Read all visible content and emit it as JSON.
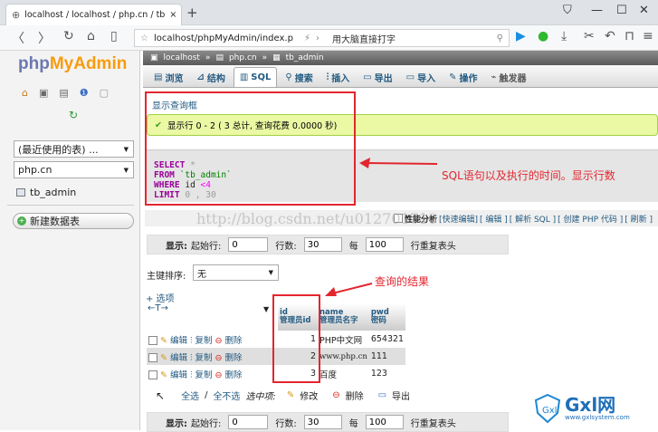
{
  "browser": {
    "tab_title": "localhost / localhost / php.cn / tb",
    "url": "localhost/phpMyAdmin/index.p",
    "url_extra": "用大脑直接打字"
  },
  "sidebar": {
    "logo_php": "php",
    "logo_myadmin": "MyAdmin",
    "recent_select": "(最近使用的表) ...",
    "db_select": "php.cn",
    "table_item": "tb_admin",
    "new_table": "新建数据表"
  },
  "breadcrumb": {
    "server": "localhost",
    "database": "php.cn",
    "table": "tb_admin"
  },
  "menu": {
    "items": [
      "浏览",
      "结构",
      "SQL",
      "搜索",
      "插入",
      "导出",
      "导入",
      "操作",
      "触发器"
    ]
  },
  "query": {
    "show_box_link": "显示查询框",
    "success_msg": "显示行 0 - 2 ( 3 总计, 查询花费 0.0000 秒)",
    "sql_select": "SELECT",
    "sql_star": "*",
    "sql_from": "FROM",
    "sql_table": "`tb_admin`",
    "sql_where": "WHERE",
    "sql_col": "id",
    "sql_op": "<",
    "sql_val": "4",
    "sql_limit": "LIMIT",
    "sql_limit_vals": "0 , 30"
  },
  "toolbar": {
    "profiling": "性能分析",
    "inline_edit": "[快速编辑]",
    "edit": "[ 编辑 ]",
    "explain": "[ 解析 SQL ]",
    "create_php": "[ 创建 PHP 代码 ]",
    "refresh": "[ 刷新 ]"
  },
  "watermark": "http://blog.csdn.net/u012701710",
  "nav": {
    "show_label": "显示:",
    "start_label": "起始行:",
    "start_value": "0",
    "rows_label": "行数:",
    "rows_value": "30",
    "per_label": "每",
    "per_value": "100",
    "repeat_label": "行重复表头"
  },
  "sort": {
    "label": "主键排序:",
    "value": "无"
  },
  "options_link": "+ 选项",
  "table": {
    "col1_top": "id",
    "col1_bottom": "管理员id",
    "col2_top": "name",
    "col2_bottom": "管理员名字",
    "col3_top": "pwd",
    "col3_bottom": "密码",
    "actions": {
      "edit": "编辑",
      "copy": "复制",
      "delete": "删除"
    },
    "rows": [
      {
        "id": "1",
        "name": "PHP中文网",
        "pwd": "654321"
      },
      {
        "id": "2",
        "name": "www.php.cn",
        "pwd": "111"
      },
      {
        "id": "3",
        "name": "百度",
        "pwd": "123"
      }
    ]
  },
  "bulk": {
    "select_all": "全选",
    "uncheck_all": "全不选",
    "with_selected": "选中项:",
    "edit": "修改",
    "delete": "删除",
    "export": "导出"
  },
  "annotations": {
    "sql_note": "SQL语句以及执行的时间。显示行数",
    "result_note": "查询的结果"
  },
  "logo_watermark": {
    "brand": "Gxl网",
    "url": "www.gxlsystem.com"
  },
  "colors": {
    "accent": "#6c78af",
    "orange": "#f89c0e",
    "annotation": "#e3262f",
    "link": "#235a81"
  }
}
